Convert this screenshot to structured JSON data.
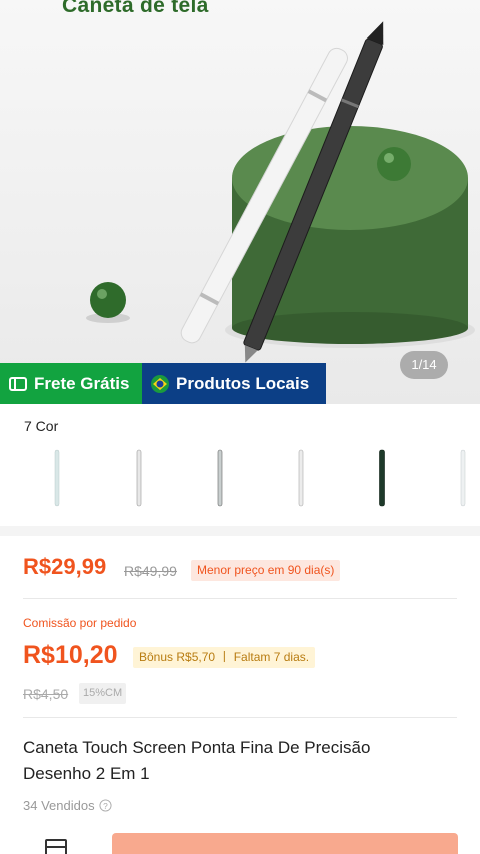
{
  "hero": {
    "title": "Caneta de tela",
    "pager": "1/14"
  },
  "badges": {
    "free_shipping": "Frete Grátis",
    "local_products": "Produtos Locais"
  },
  "variants": {
    "label": "7 Cor",
    "swatch_colors": [
      "#d9e7e7",
      "#e8e8e8",
      "#c9cfcf",
      "#ececec",
      "#1e3a2a",
      "#eef1f2"
    ]
  },
  "pricing": {
    "price": "R$29,99",
    "old_price": "R$49,99",
    "lowest_badge": "Menor preço em 90 dia(s)"
  },
  "commission": {
    "label": "Comissão por pedido",
    "value": "R$10,20",
    "bonus": "Bônus R$5,70 丨 Faltam 7 dias.",
    "old_value": "R$4,50",
    "percent": "15%CM"
  },
  "product": {
    "title": "Caneta Touch Screen Ponta Fina De Precisão Desenho 2 Em 1",
    "sold": "34 Vendidos"
  },
  "colors": {
    "accent": "#f0541e",
    "free_badge": "#12a340",
    "local_badge": "#0c3f86",
    "cta": "#f8a98e"
  }
}
